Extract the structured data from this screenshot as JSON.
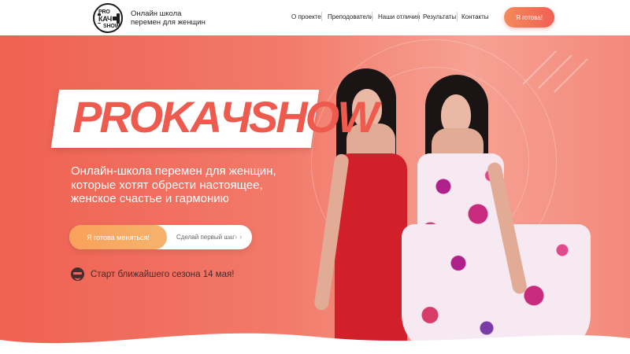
{
  "header": {
    "logo_lines": [
      "PRO",
      "КАЧ",
      "SHOW"
    ],
    "tagline_line1": "Онлайн школа",
    "tagline_line2": "перемен для женщин",
    "nav": [
      "О проекте",
      "Преподователи",
      "Наши отличия",
      "Результаты",
      "Контакты"
    ],
    "cta_label": "Я готова!"
  },
  "hero": {
    "title": "PROKAЧSHOW",
    "description": "Онлайн-школа перемен для женщин, которые хотят обрести настоящее, женское счастье и гармонию",
    "primary_button": "Я готова меняться!",
    "secondary_link": "Сделай первый шаг",
    "start_text": "Старт ближайшего сезона 14 мая!"
  },
  "icons": {
    "start": "cool-face-icon",
    "chevrons": "chevron-right-icon"
  },
  "colors": {
    "accent": "#ef5a4e",
    "button_orange": "#f9a15a",
    "dark_text": "#4a2a2c"
  }
}
